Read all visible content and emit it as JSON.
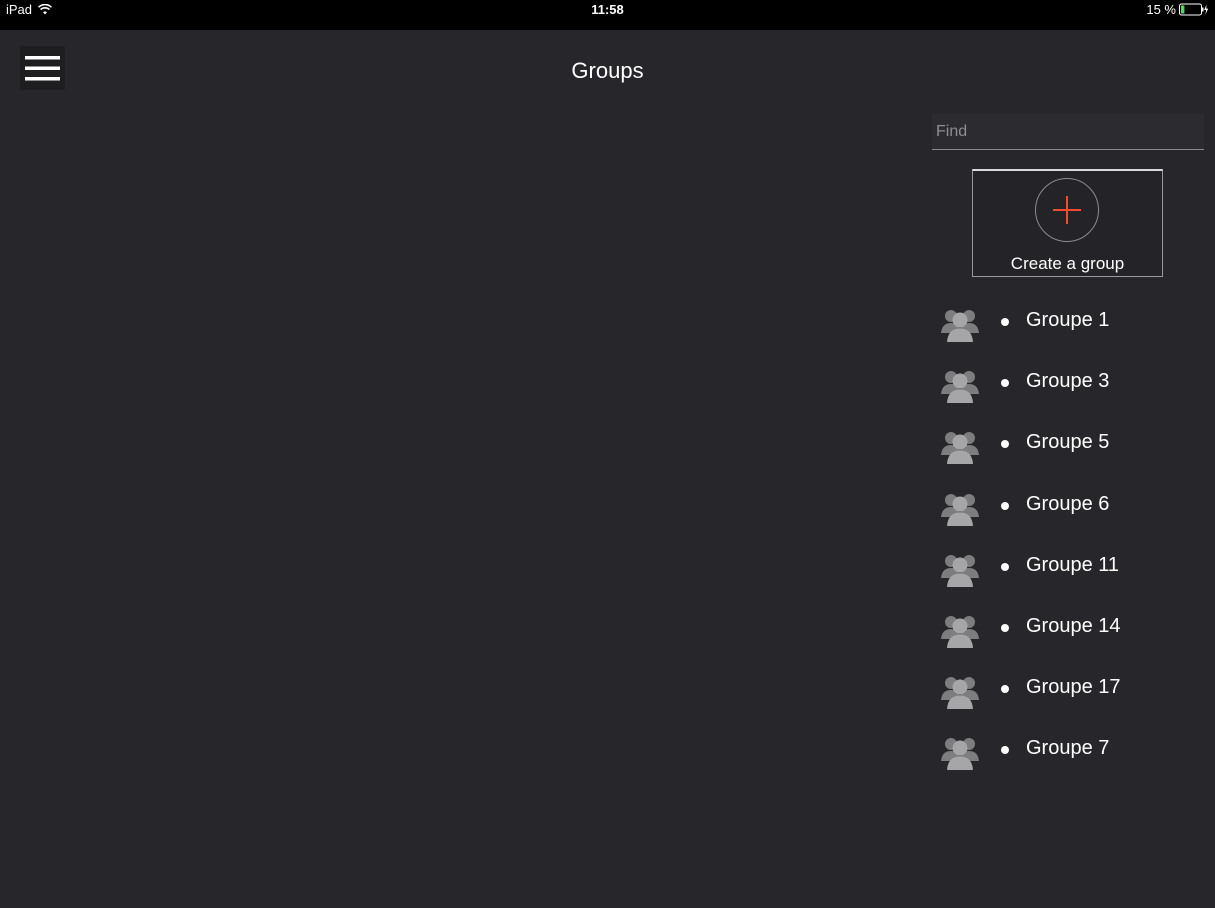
{
  "status_bar": {
    "device": "iPad",
    "time": "11:58",
    "battery": "15 %"
  },
  "header": {
    "title": "Groups"
  },
  "search": {
    "placeholder": "Find"
  },
  "create_group": {
    "label": "Create a group"
  },
  "groups": [
    {
      "name": "Groupe 1"
    },
    {
      "name": "Groupe 3"
    },
    {
      "name": "Groupe 5"
    },
    {
      "name": "Groupe 6"
    },
    {
      "name": "Groupe 11"
    },
    {
      "name": "Groupe 14"
    },
    {
      "name": "Groupe 17"
    },
    {
      "name": "Groupe 7"
    }
  ],
  "colors": {
    "background": "#27272b",
    "status_bar": "#000000",
    "accent_plus": "#f04a32",
    "text": "#ffffff"
  },
  "icons": {
    "menu": "hamburger-menu-icon",
    "create": "plus-icon",
    "group": "group-people-icon",
    "wifi": "wifi-icon",
    "battery": "battery-charging-icon"
  }
}
